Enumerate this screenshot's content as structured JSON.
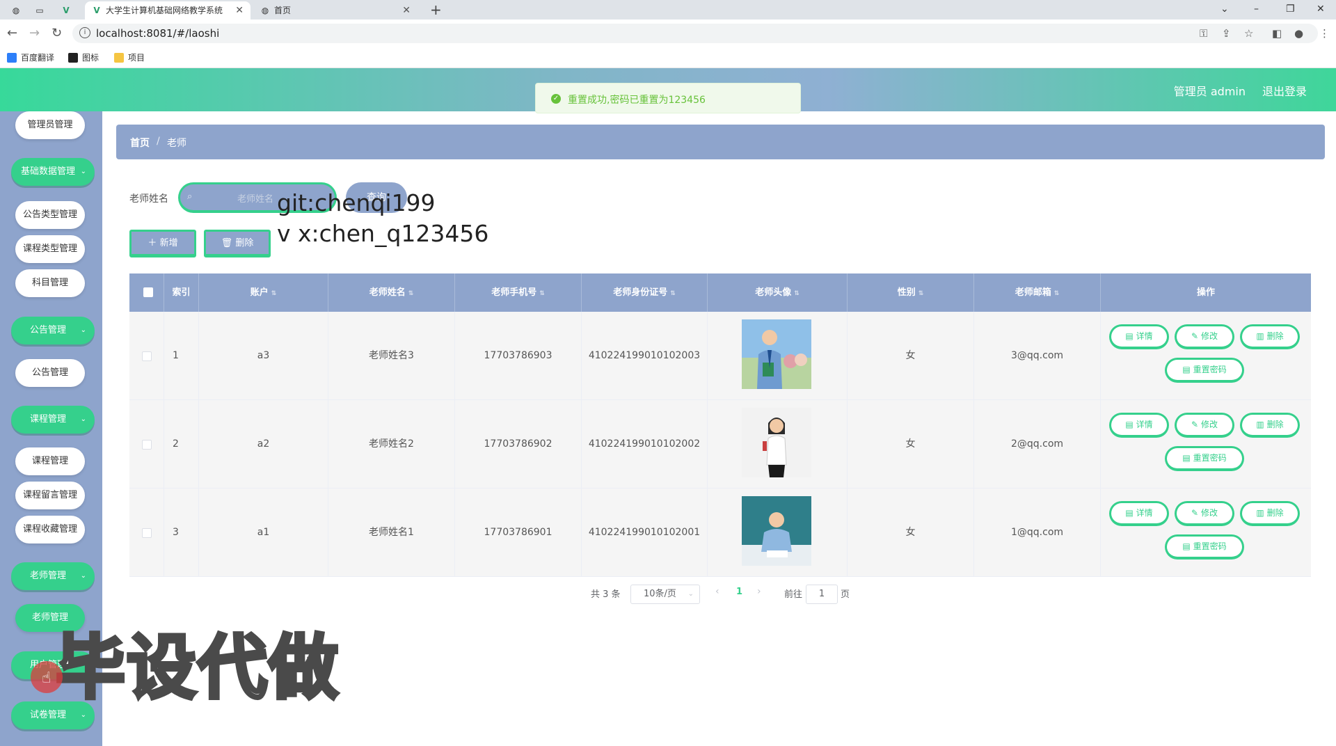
{
  "browser": {
    "tabs": [
      {
        "icon": "globe-icon",
        "title": ""
      },
      {
        "icon": "blank-icon",
        "title": ""
      },
      {
        "icon": "vue-icon",
        "title": ""
      },
      {
        "icon": "vue-icon",
        "title": "大学生计算机基础网络教学系统"
      },
      {
        "icon": "globe-icon",
        "title": "首页"
      }
    ],
    "url": "localhost:8081/#/laoshi",
    "bookmarks": [
      "百度翻译",
      "图标",
      "项目"
    ]
  },
  "header": {
    "user": "管理员 admin",
    "logout": "退出登录"
  },
  "toast": {
    "message": "重置成功,密码已重置为123456",
    "color": "#67c23a"
  },
  "sidebar": {
    "items": [
      {
        "label": "管理员管理",
        "type": "sub"
      },
      {
        "label": "基础数据管理",
        "type": "group"
      },
      {
        "label": "公告类型管理",
        "type": "sub"
      },
      {
        "label": "课程类型管理",
        "type": "sub"
      },
      {
        "label": "科目管理",
        "type": "sub"
      },
      {
        "label": "公告管理",
        "type": "group"
      },
      {
        "label": "公告管理",
        "type": "sub"
      },
      {
        "label": "课程管理",
        "type": "group"
      },
      {
        "label": "课程管理",
        "type": "sub"
      },
      {
        "label": "课程留言管理",
        "type": "sub"
      },
      {
        "label": "课程收藏管理",
        "type": "sub"
      },
      {
        "label": "老师管理",
        "type": "group"
      },
      {
        "label": "老师管理",
        "type": "sub"
      },
      {
        "label": "用户管理",
        "type": "group"
      },
      {
        "label": "试卷管理",
        "type": "group"
      }
    ]
  },
  "breadcrumb": {
    "home": "首页",
    "separator": "/",
    "current": "老师"
  },
  "search": {
    "label": "老师姓名",
    "placeholder": "老师姓名",
    "button": "查询"
  },
  "actions": {
    "add": "新增",
    "delete": "删除"
  },
  "watermark": {
    "line1": "git:chenqi199",
    "line2": "v x:chen_q123456",
    "line3": "毕设代做"
  },
  "table": {
    "headers": [
      "索引",
      "账户",
      "老师姓名",
      "老师手机号",
      "老师身份证号",
      "老师头像",
      "性别",
      "老师邮箱",
      "操作"
    ],
    "rows": [
      {
        "index": "1",
        "account": "a3",
        "name": "老师姓名3",
        "phone": "17703786903",
        "idcard": "410224199010102003",
        "avatar": "teacher-photo-male-books",
        "gender": "女",
        "email": "3@qq.com"
      },
      {
        "index": "2",
        "account": "a2",
        "name": "老师姓名2",
        "phone": "17703786902",
        "idcard": "410224199010102002",
        "avatar": "teacher-photo-female",
        "gender": "女",
        "email": "2@qq.com"
      },
      {
        "index": "3",
        "account": "a1",
        "name": "老师姓名1",
        "phone": "17703786901",
        "idcard": "410224199010102001",
        "avatar": "teacher-photo-male-desk",
        "gender": "女",
        "email": "1@qq.com"
      }
    ],
    "ops": {
      "detail": "详情",
      "edit": "修改",
      "delete": "删除",
      "reset": "重置密码"
    }
  },
  "pagination": {
    "total": "共 3 条",
    "page_size": "10条/页",
    "current": "1",
    "goto": "前往",
    "goto_value": "1",
    "page_unit": "页"
  },
  "colors": {
    "accent": "#35d08c",
    "panel": "#8ea4cc"
  }
}
